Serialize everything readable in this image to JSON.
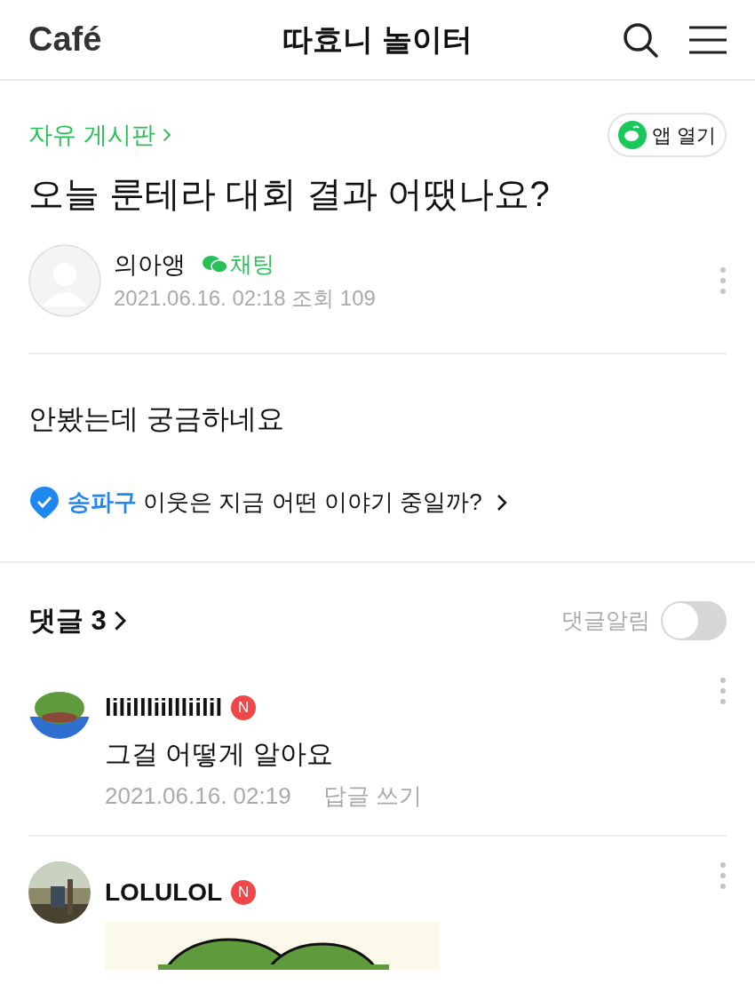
{
  "header": {
    "logo": "Café",
    "title": "따효니 놀이터"
  },
  "post": {
    "board": "자유 게시판",
    "open_app": "앱 열기",
    "title": "오늘 룬테라 대회 결과 어땠나요?",
    "author": "의아앵",
    "chat": "채팅",
    "meta": "2021.06.16. 02:18 조회 109",
    "body": "안봤는데 궁금하네요"
  },
  "local_banner": {
    "region": "송파구",
    "text": "이웃은 지금 어떤 이야기 중일까?"
  },
  "comments_header": {
    "label": "댓글 3",
    "alert_label": "댓글알림",
    "alert_on": false
  },
  "comments": [
    {
      "author": "lilillliillliilil",
      "badge": "N",
      "text": "그걸 어떻게 알아요",
      "date": "2021.06.16. 02:19",
      "reply": "답글 쓰기"
    },
    {
      "author": "LOLULOL",
      "badge": "N"
    }
  ]
}
